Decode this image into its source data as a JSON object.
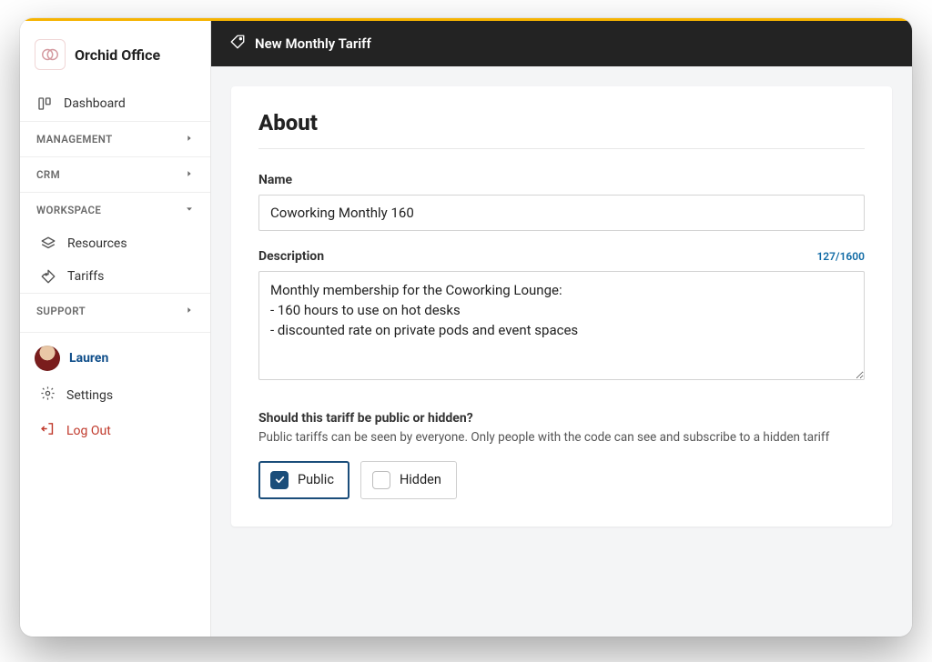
{
  "brand": {
    "name": "Orchid Office"
  },
  "topbar": {
    "title": "New Monthly Tariff"
  },
  "sidebar": {
    "dashboard": "Dashboard",
    "sections": {
      "management": "MANAGEMENT",
      "crm": "CRM",
      "workspace": "WORKSPACE",
      "support": "SUPPORT"
    },
    "workspace_items": {
      "resources": "Resources",
      "tariffs": "Tariffs"
    },
    "user": "Lauren",
    "settings": "Settings",
    "logout": "Log Out"
  },
  "about": {
    "heading": "About",
    "name_label": "Name",
    "name_value": "Coworking Monthly 160",
    "description_label": "Description",
    "description_counter": "127/1600",
    "description_value": "Monthly membership for the Coworking Lounge:\n- 160 hours to use on hot desks\n- discounted rate on private pods and event spaces",
    "visibility_question": "Should this tariff be public or hidden?",
    "visibility_help": "Public tariffs can be seen by everyone. Only people with the code can see and subscribe to a hidden tariff",
    "option_public": "Public",
    "option_hidden": "Hidden",
    "selected": "public"
  }
}
